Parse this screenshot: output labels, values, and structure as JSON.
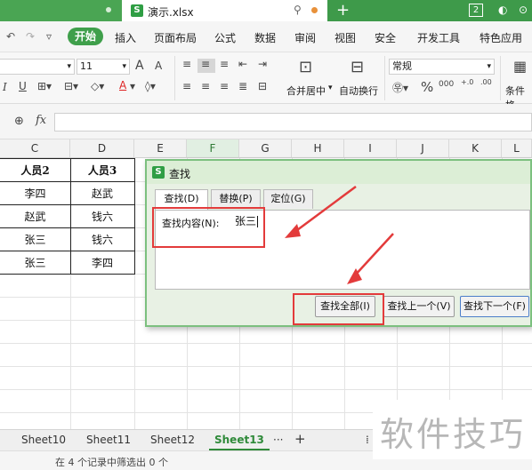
{
  "titlebar": {
    "doc_icon": "S",
    "doc_name": "演示.xlsx",
    "window_count": "2"
  },
  "menubar": {
    "start": "开始",
    "items": [
      "插入",
      "页面布局",
      "公式",
      "数据",
      "审阅",
      "视图",
      "安全",
      "开发工具",
      "特色应用"
    ]
  },
  "ribbon": {
    "font_size": "11",
    "number_format": "常规",
    "merge_label": "合并居中",
    "wrap_label": "自动换行",
    "cond_label": "条件格",
    "percent": "%",
    "dec_inc": "000",
    "dec_a": "+.0",
    "dec_b": ".00",
    "font_grow": "A",
    "font_shrink": "A",
    "bold_u": "U",
    "italic_i": "I",
    "font_color": "A"
  },
  "formula_bar": {
    "fx": "fx",
    "value": ""
  },
  "columns": [
    "C",
    "D",
    "E",
    "F",
    "G",
    "H",
    "I",
    "J",
    "K",
    "L"
  ],
  "table": {
    "headers": [
      "人员2",
      "人员3"
    ],
    "rows": [
      [
        "李四",
        "赵武"
      ],
      [
        "赵武",
        "钱六"
      ],
      [
        "张三",
        "钱六"
      ],
      [
        "张三",
        "李四"
      ]
    ]
  },
  "dialog": {
    "icon": "S",
    "title": "查找",
    "tabs": [
      "查找(D)",
      "替换(P)",
      "定位(G)"
    ],
    "find_label": "查找内容(N):",
    "find_value": "张三",
    "buttons": {
      "find_all": "查找全部(I)",
      "find_prev": "查找上一个(V)",
      "find_next": "查找下一个(F)"
    }
  },
  "sheets": [
    "Sheet10",
    "Sheet11",
    "Sheet12",
    "Sheet13"
  ],
  "active_sheet": "Sheet13",
  "sheet_more": "···",
  "sheet_add": "+",
  "status": "在 4 个记录中筛选出 0 个",
  "watermark": "软件技巧",
  "colors": {
    "accent": "#3e9a4a",
    "highlight_red": "#e33b3b"
  }
}
